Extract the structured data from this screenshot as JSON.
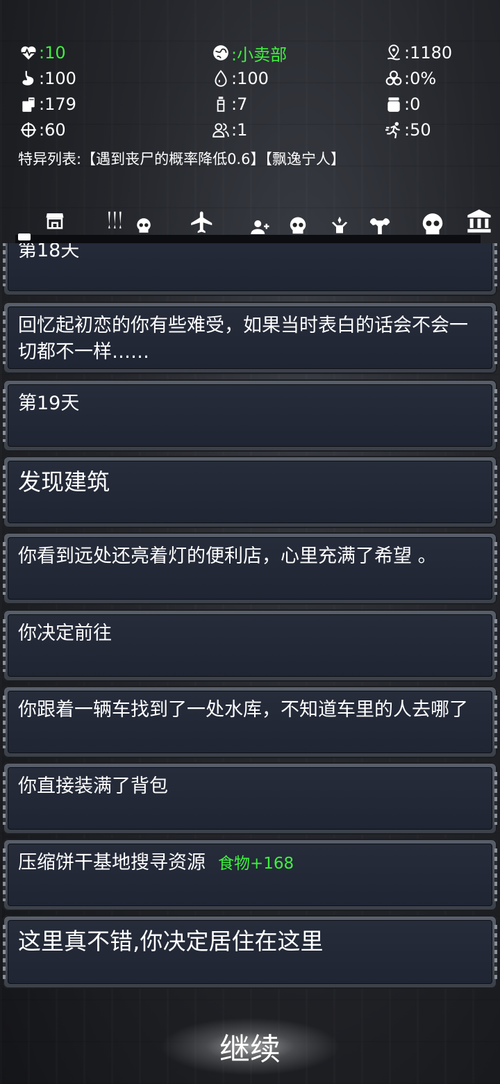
{
  "stats": {
    "health": {
      "icon": "heartbeat-icon",
      "value": ":10"
    },
    "location": {
      "icon": "globe-pin-icon",
      "value": ":小卖部"
    },
    "distance": {
      "icon": "map-pin-icon",
      "value": ":1180"
    },
    "stomach": {
      "icon": "stomach-icon",
      "value": ":100"
    },
    "water": {
      "icon": "water-drop-icon",
      "value": ":100"
    },
    "infection": {
      "icon": "biohazard-icon",
      "value": ":0%"
    },
    "food": {
      "icon": "food-can-icon",
      "value": ":179"
    },
    "drink": {
      "icon": "bottle-icon",
      "value": ":7"
    },
    "medkit": {
      "icon": "jar-icon",
      "value": ":0"
    },
    "accuracy": {
      "icon": "crosshair-icon",
      "value": ":60"
    },
    "people": {
      "icon": "people-icon",
      "value": ":1"
    },
    "speed": {
      "icon": "runner-icon",
      "value": ":50"
    }
  },
  "traits": "特异列表:【遇到丧尸的概率降低0.6】【飘逸宁人】",
  "nav": [
    "store-icon",
    "weapons-icon",
    "skull-small-icon",
    "airplane-icon",
    "add-person-icon",
    "skull-icon",
    "hands-icon",
    "muscle-icon",
    "skull-large-icon",
    "bank-icon"
  ],
  "log": [
    {
      "text": "第18天"
    },
    {
      "text": "回忆起初恋的你有些难受，如果当时表白的话会不会一切都不一样……"
    },
    {
      "text": "第19天"
    },
    {
      "text": "发现建筑"
    },
    {
      "text": "你看到远处还亮着灯的便利店，心里充满了希望 。"
    },
    {
      "text": "你决定前往"
    },
    {
      "text": "你跟着一辆车找到了一处水库，不知道车里的人去哪了"
    },
    {
      "text": "你直接装满了背包"
    },
    {
      "text": "压缩饼干基地搜寻资源",
      "reward": "食物+168"
    },
    {
      "text": "这里真不错,你决定居住在这里"
    }
  ],
  "continue_label": "继续",
  "colors": {
    "accent_green": "#3ef03e",
    "heading_green": "#8ee88a",
    "alert_red": "#f07c78"
  }
}
